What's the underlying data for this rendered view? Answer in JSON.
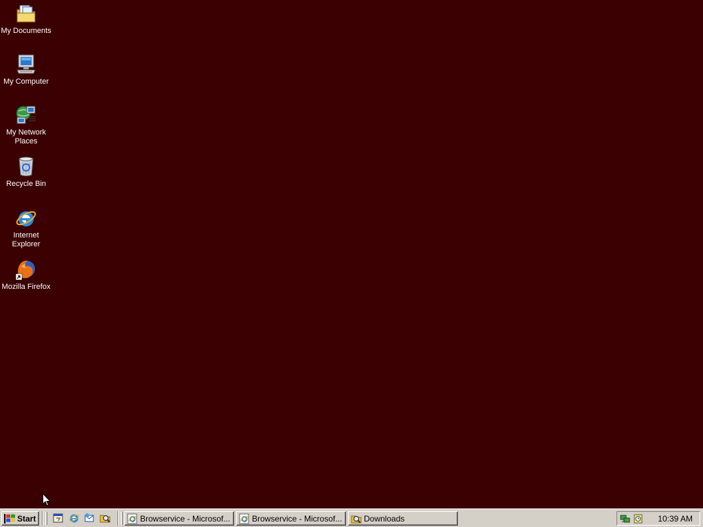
{
  "colors": {
    "desktop_background": "#3a0002",
    "taskbar_face": "#d4d0c8"
  },
  "desktop": {
    "icons": [
      {
        "label": "My Documents",
        "icon": "my-documents-folder-icon"
      },
      {
        "label": "My Computer",
        "icon": "my-computer-icon"
      },
      {
        "label": "My Network Places",
        "icon": "network-places-icon"
      },
      {
        "label": "Recycle Bin",
        "icon": "recycle-bin-icon"
      },
      {
        "label": "Internet Explorer",
        "icon": "internet-explorer-icon"
      },
      {
        "label": "Mozilla Firefox",
        "icon": "firefox-shortcut-icon"
      }
    ]
  },
  "taskbar": {
    "start_label": "Start",
    "quick_launch": [
      {
        "icon": "show-desktop-icon"
      },
      {
        "icon": "internet-explorer-icon"
      },
      {
        "icon": "outlook-express-icon"
      },
      {
        "icon": "explorer-search-icon"
      }
    ],
    "tasks": [
      {
        "label": "Browservice - Microsof...",
        "icon": "internet-explorer-icon"
      },
      {
        "label": "Browservice - Microsof...",
        "icon": "internet-explorer-icon"
      },
      {
        "label": "Downloads",
        "icon": "folder-search-icon"
      }
    ],
    "tray_icons": [
      {
        "icon": "network-activity-icon"
      },
      {
        "icon": "scheduled-task-icon"
      }
    ],
    "clock": "10:39 AM"
  }
}
